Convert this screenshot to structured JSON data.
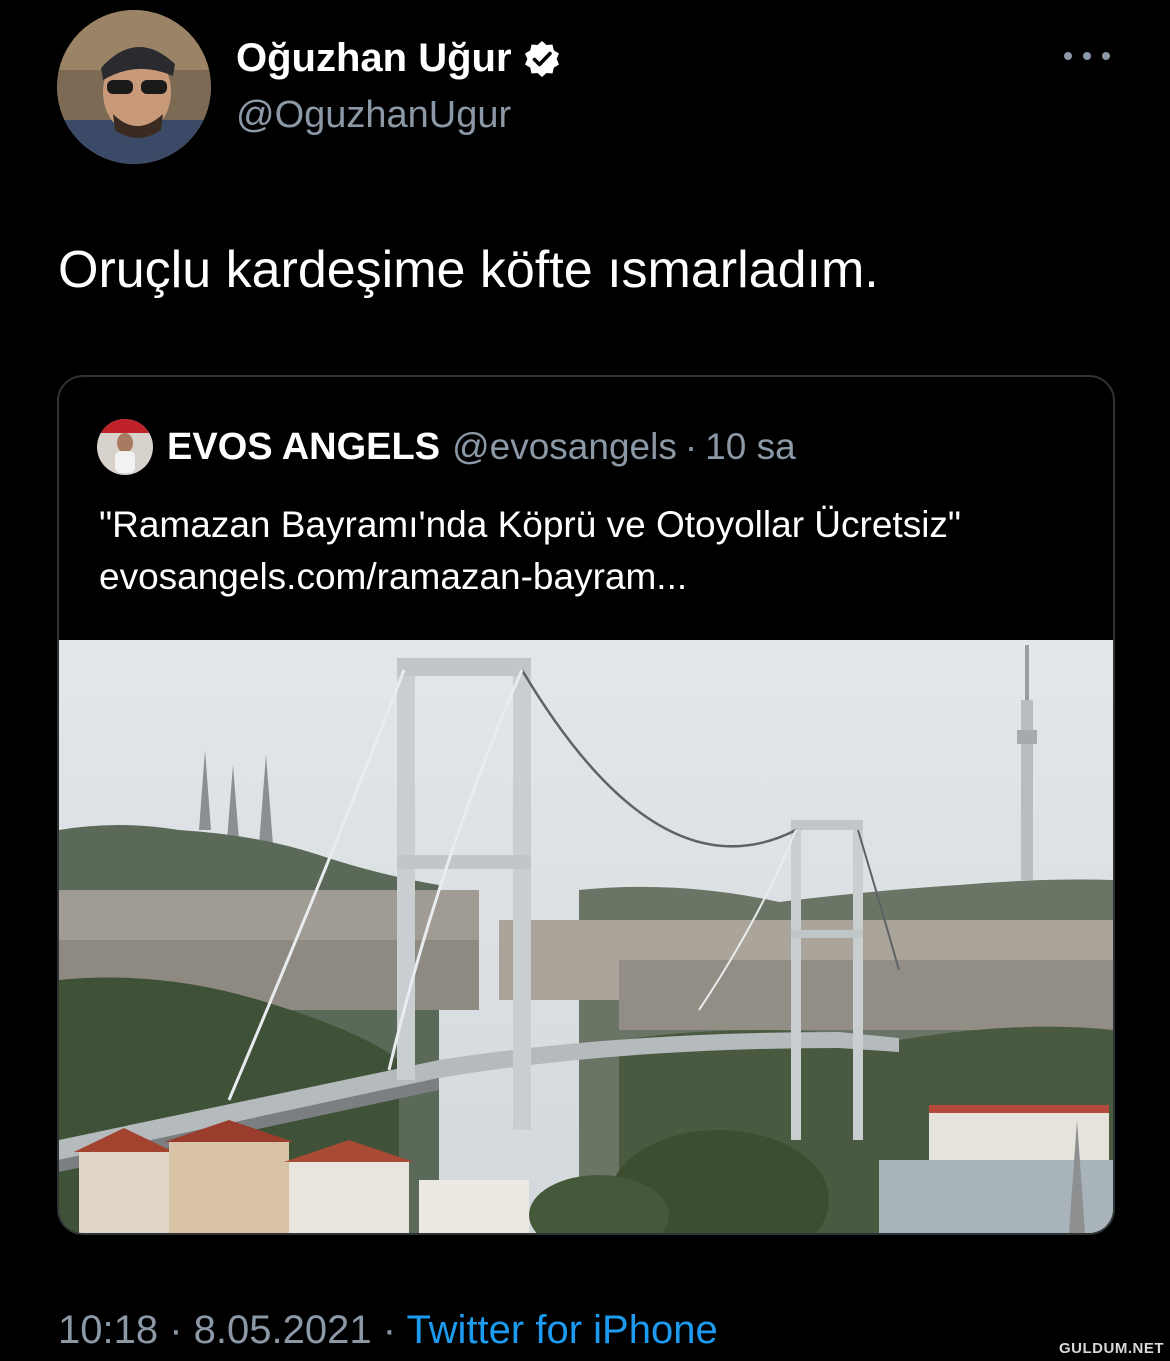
{
  "tweet": {
    "author": {
      "display_name": "Oğuzhan Uğur",
      "handle": "@OguzhanUgur",
      "verified_icon": "verified-badge-icon"
    },
    "more_icon": "more-options-icon",
    "text": "Oruçlu kardeşime köfte ısmarladım.",
    "quoted_tweet": {
      "display_name": "EVOS ANGELS",
      "handle": "@evosangels",
      "separator": "·",
      "time": "10 sa",
      "text": "\"Ramazan Bayramı'nda Köprü ve Otoyollar Ücretsiz\" evosangels.com/ramazan-bayram...",
      "image": "bosphorus-bridge-photo"
    },
    "meta": {
      "time": "10:18",
      "sep1": " · ",
      "date": "8.05.2021",
      "sep2": " · ",
      "source": "Twitter for iPhone"
    }
  },
  "watermark": "GULDUM.NET",
  "colors": {
    "background": "#000000",
    "text_primary": "#ffffff",
    "text_secondary": "#8b98a5",
    "link": "#1d9bf0",
    "border": "#2f3336"
  }
}
